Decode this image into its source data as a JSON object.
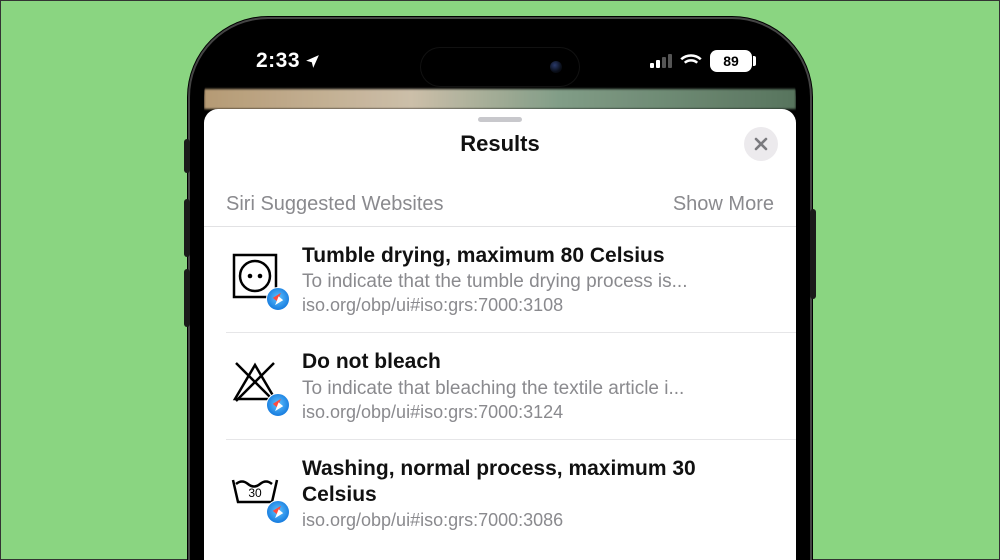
{
  "status": {
    "time": "2:33",
    "battery": "89"
  },
  "sheet": {
    "title": "Results",
    "section_label": "Siri Suggested Websites",
    "show_more": "Show More"
  },
  "results": [
    {
      "icon": "tumble-dry",
      "title": "Tumble drying, maximum 80 Celsius",
      "subtitle": "To indicate that the tumble drying process is...",
      "url": "iso.org/obp/ui#iso:grs:7000:3108"
    },
    {
      "icon": "no-bleach",
      "title": "Do not bleach",
      "subtitle": "To indicate that bleaching the textile article i...",
      "url": "iso.org/obp/ui#iso:grs:7000:3124"
    },
    {
      "icon": "wash-30",
      "title": "Washing, normal process, maximum 30 Celsius",
      "subtitle": "",
      "url": "iso.org/obp/ui#iso:grs:7000:3086"
    }
  ]
}
